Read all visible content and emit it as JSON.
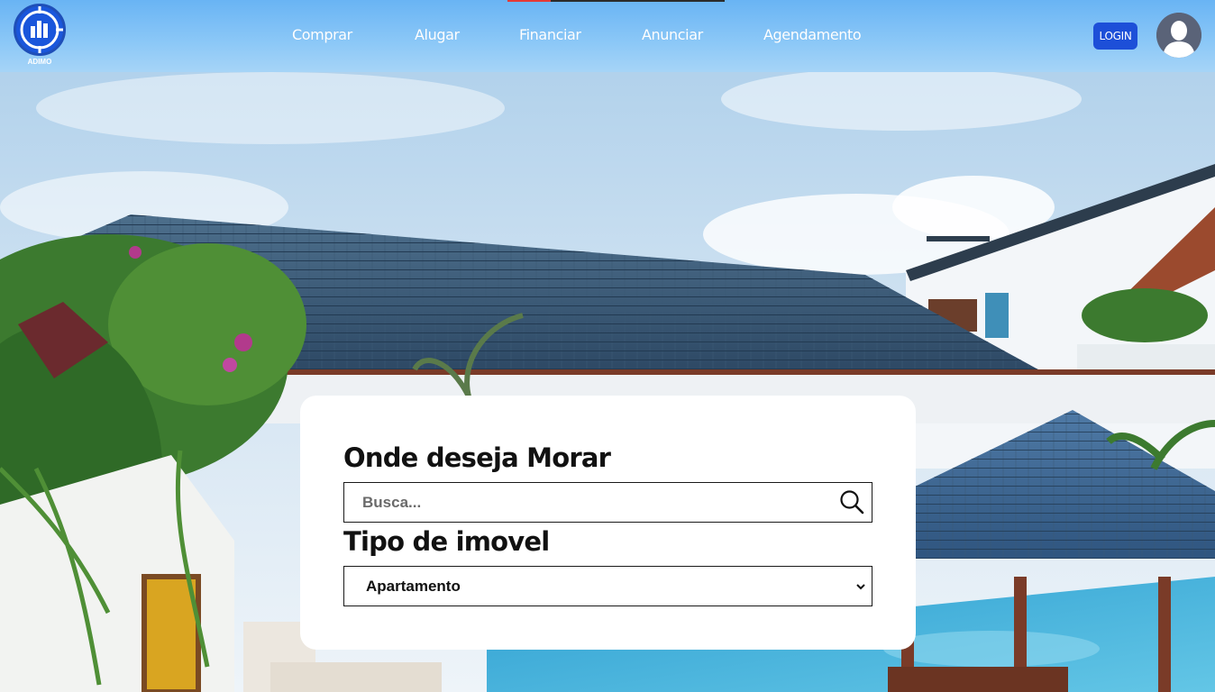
{
  "app": {
    "logo_text": "ADIMO"
  },
  "nav": {
    "items": [
      "Comprar",
      "Alugar",
      "Financiar",
      "Anunciar",
      "Agendamento"
    ]
  },
  "header": {
    "login_label": "LOGIN",
    "page_progress": 0.2
  },
  "search_card": {
    "location_label": "Onde deseja Morar",
    "search_placeholder": "Busca...",
    "search_value": "",
    "property_type_label": "Tipo de imovel",
    "property_type_selected": "Apartamento"
  },
  "colors": {
    "header_bg": "#8cc8f7",
    "accent": "#1d4fd8",
    "progress": "#e53935"
  },
  "icons": {
    "logo": "bar-chart-logo-icon",
    "search": "magnifier-icon",
    "avatar": "user-silhouette-icon",
    "select": "chevron-down-icon"
  }
}
